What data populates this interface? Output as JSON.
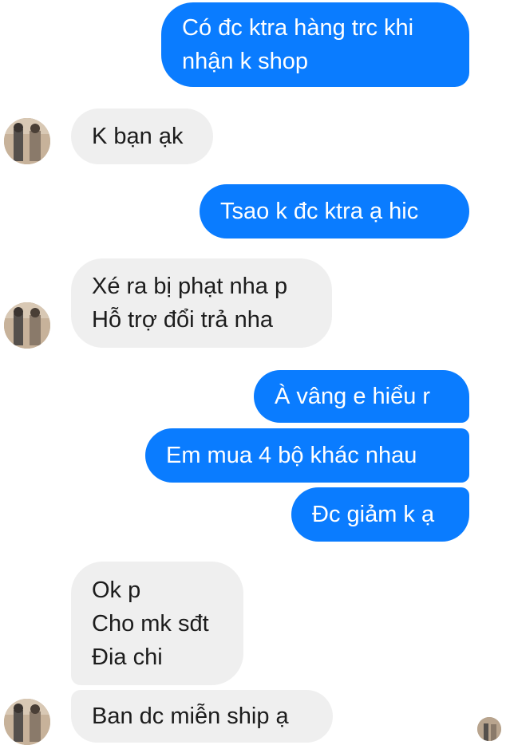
{
  "messages": [
    {
      "side": "out",
      "lines": [
        "Có đc ktra hàng trc khi",
        "nhận k shop"
      ]
    },
    {
      "side": "in",
      "lines": [
        "K bạn ạk"
      ]
    },
    {
      "side": "out",
      "lines": [
        "Tsao k đc ktra ạ hic"
      ]
    },
    {
      "side": "in",
      "lines": [
        "Xé ra bị phạt nha p",
        "Hỗ trợ đổi trả nha"
      ]
    },
    {
      "side": "out",
      "lines": [
        "À vâng e hiểu r"
      ]
    },
    {
      "side": "out",
      "lines": [
        "Em mua 4 bộ khác nhau"
      ]
    },
    {
      "side": "out",
      "lines": [
        "Đc giảm k ạ"
      ]
    },
    {
      "side": "in",
      "lines": [
        "Ok p",
        "Cho mk sđt",
        "Đia chi"
      ]
    },
    {
      "side": "in",
      "lines": [
        "Ban dc miễn ship ạ"
      ]
    }
  ],
  "colors": {
    "outgoing": "#0a7cff",
    "incoming": "#efefef"
  },
  "icons": {
    "avatar": "shop-avatar"
  }
}
